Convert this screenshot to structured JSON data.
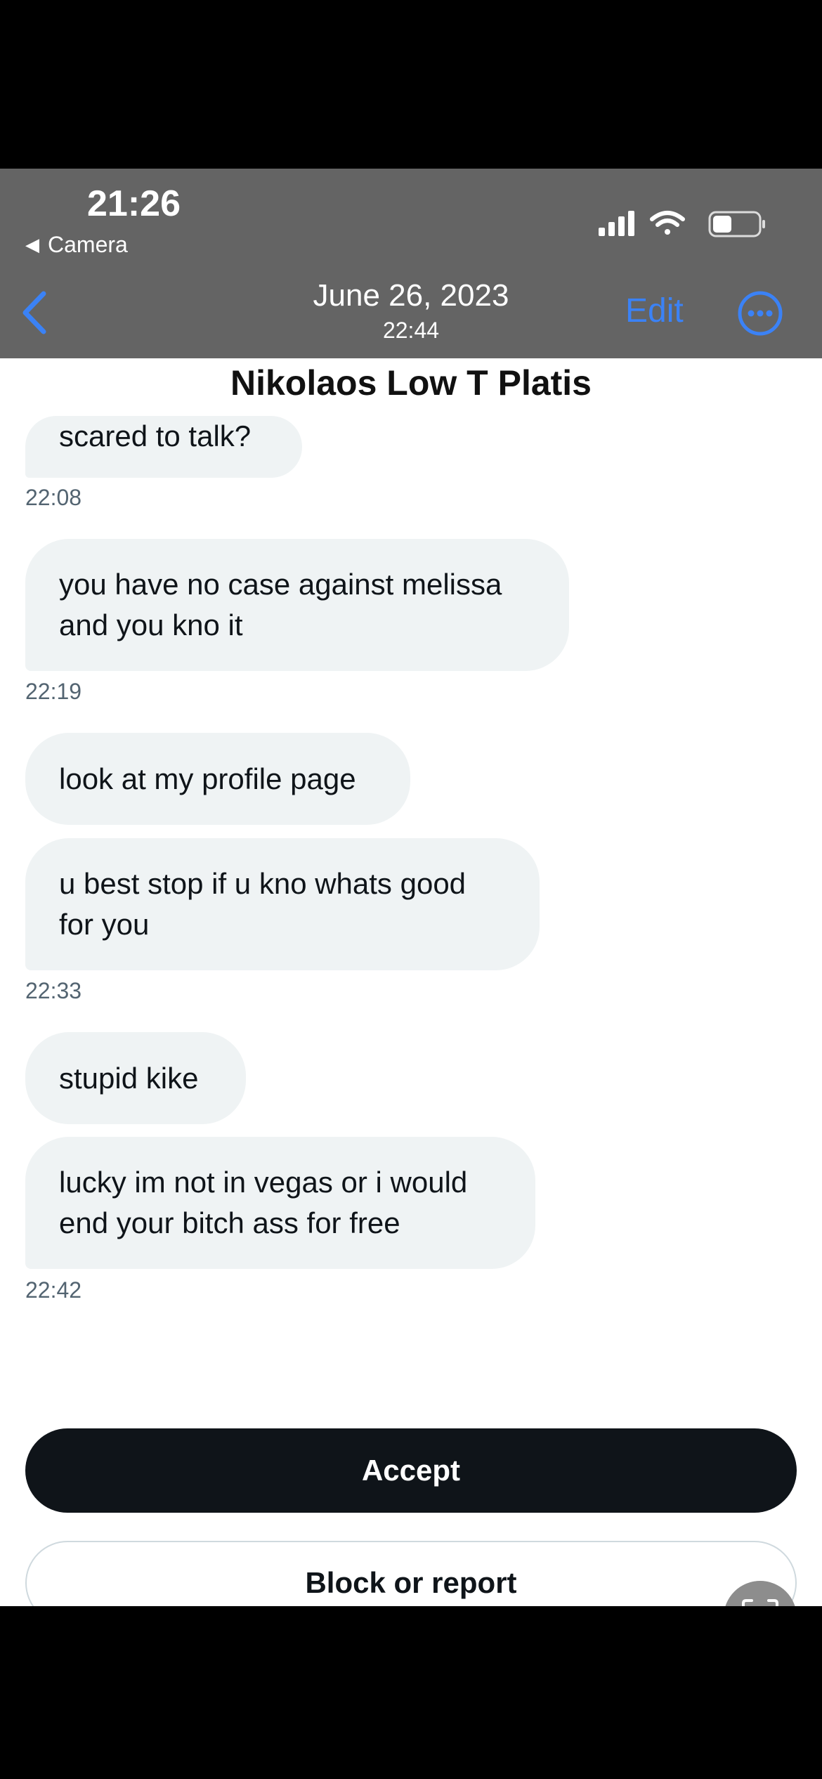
{
  "status_bar": {
    "time": "21:26",
    "back_app": "Camera"
  },
  "header": {
    "date": "June 26, 2023",
    "time": "22:44",
    "edit_label": "Edit",
    "back_icon": "chevron-left-icon",
    "more_icon": "more-circle-icon"
  },
  "conversation": {
    "contact_name": "Nikolaos Low T Platis",
    "messages": [
      {
        "text": "scared to talk?",
        "timestamp": "22:08"
      },
      {
        "text": "you have no case against melissa\nand you kno it",
        "timestamp": "22:19"
      },
      {
        "text": "look at my profile page",
        "timestamp": ""
      },
      {
        "text": "u best stop if u kno whats good\nfor you",
        "timestamp": "22:33"
      },
      {
        "text": "stupid kike",
        "timestamp": ""
      },
      {
        "text": "lucky im not in vegas or i would\nend your bitch ass for free",
        "timestamp": "22:42"
      }
    ]
  },
  "actions": {
    "accept_label": "Accept",
    "block_label": "Block or report",
    "scan_icon": "text-scan-icon"
  },
  "colors": {
    "accent": "#3b82f6",
    "bubble": "#eff3f4",
    "primary_button": "#0f1419"
  }
}
